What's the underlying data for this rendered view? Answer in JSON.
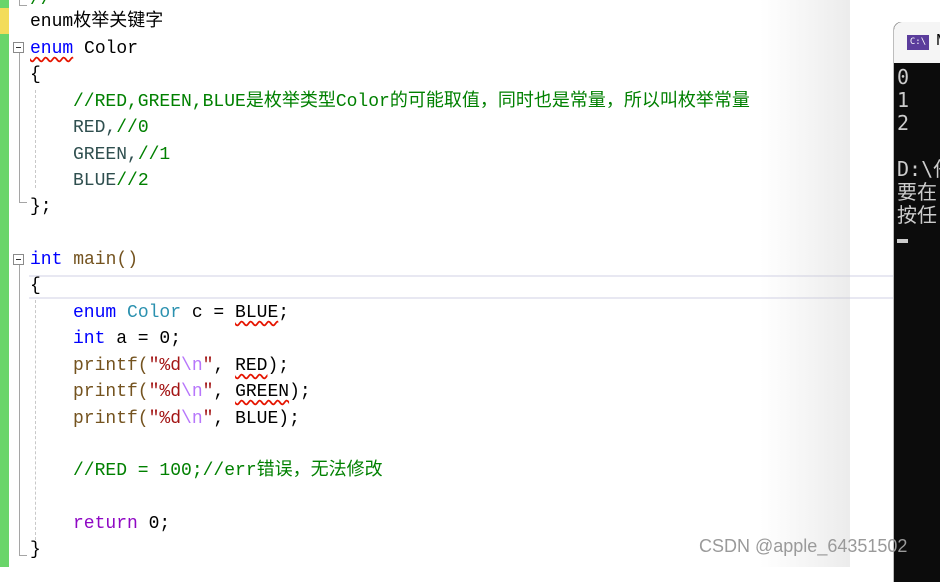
{
  "editor": {
    "lines": {
      "l0": "//",
      "l1": "enum枚举关键字",
      "l2_kw": "enum",
      "l2_name": " Color",
      "l3": "{",
      "l4": "//RED,GREEN,BLUE是枚举类型Color的可能取值，同时也是常量，所以叫枚举常量",
      "l5_id": "RED,",
      "l5_cm": "//0",
      "l6_id": "GREEN,",
      "l6_cm": "//1",
      "l7_id": "BLUE",
      "l7_cm": "//2",
      "l8": "};",
      "l10_kw": "int",
      "l10_fn": " main()",
      "l11": "{",
      "l12_kw": "enum",
      "l12_type": " Color",
      "l12_rest1": " c = ",
      "l12_id": "BLUE",
      "l12_end": ";",
      "l13_kw": "int",
      "l13_rest": " a = 0;",
      "printf": "printf(",
      "fmt_q1": "\"%d",
      "fmt_esc": "\\n",
      "fmt_q2": "\"",
      "comma": ", ",
      "arg_red": "RED",
      "arg_green": "GREEN",
      "arg_blue": "BLUE",
      "call_end": ");",
      "l18": "//RED = 100;//err错误，无法修改",
      "l20_kw": "return",
      "l20_rest": " 0;",
      "l21": "}"
    }
  },
  "console": {
    "title": "M",
    "icon": "C:\\",
    "output": "0\n1\n2\n\nD:\\任\n要在\n按任"
  },
  "watermark": "CSDN @apple_64351502"
}
